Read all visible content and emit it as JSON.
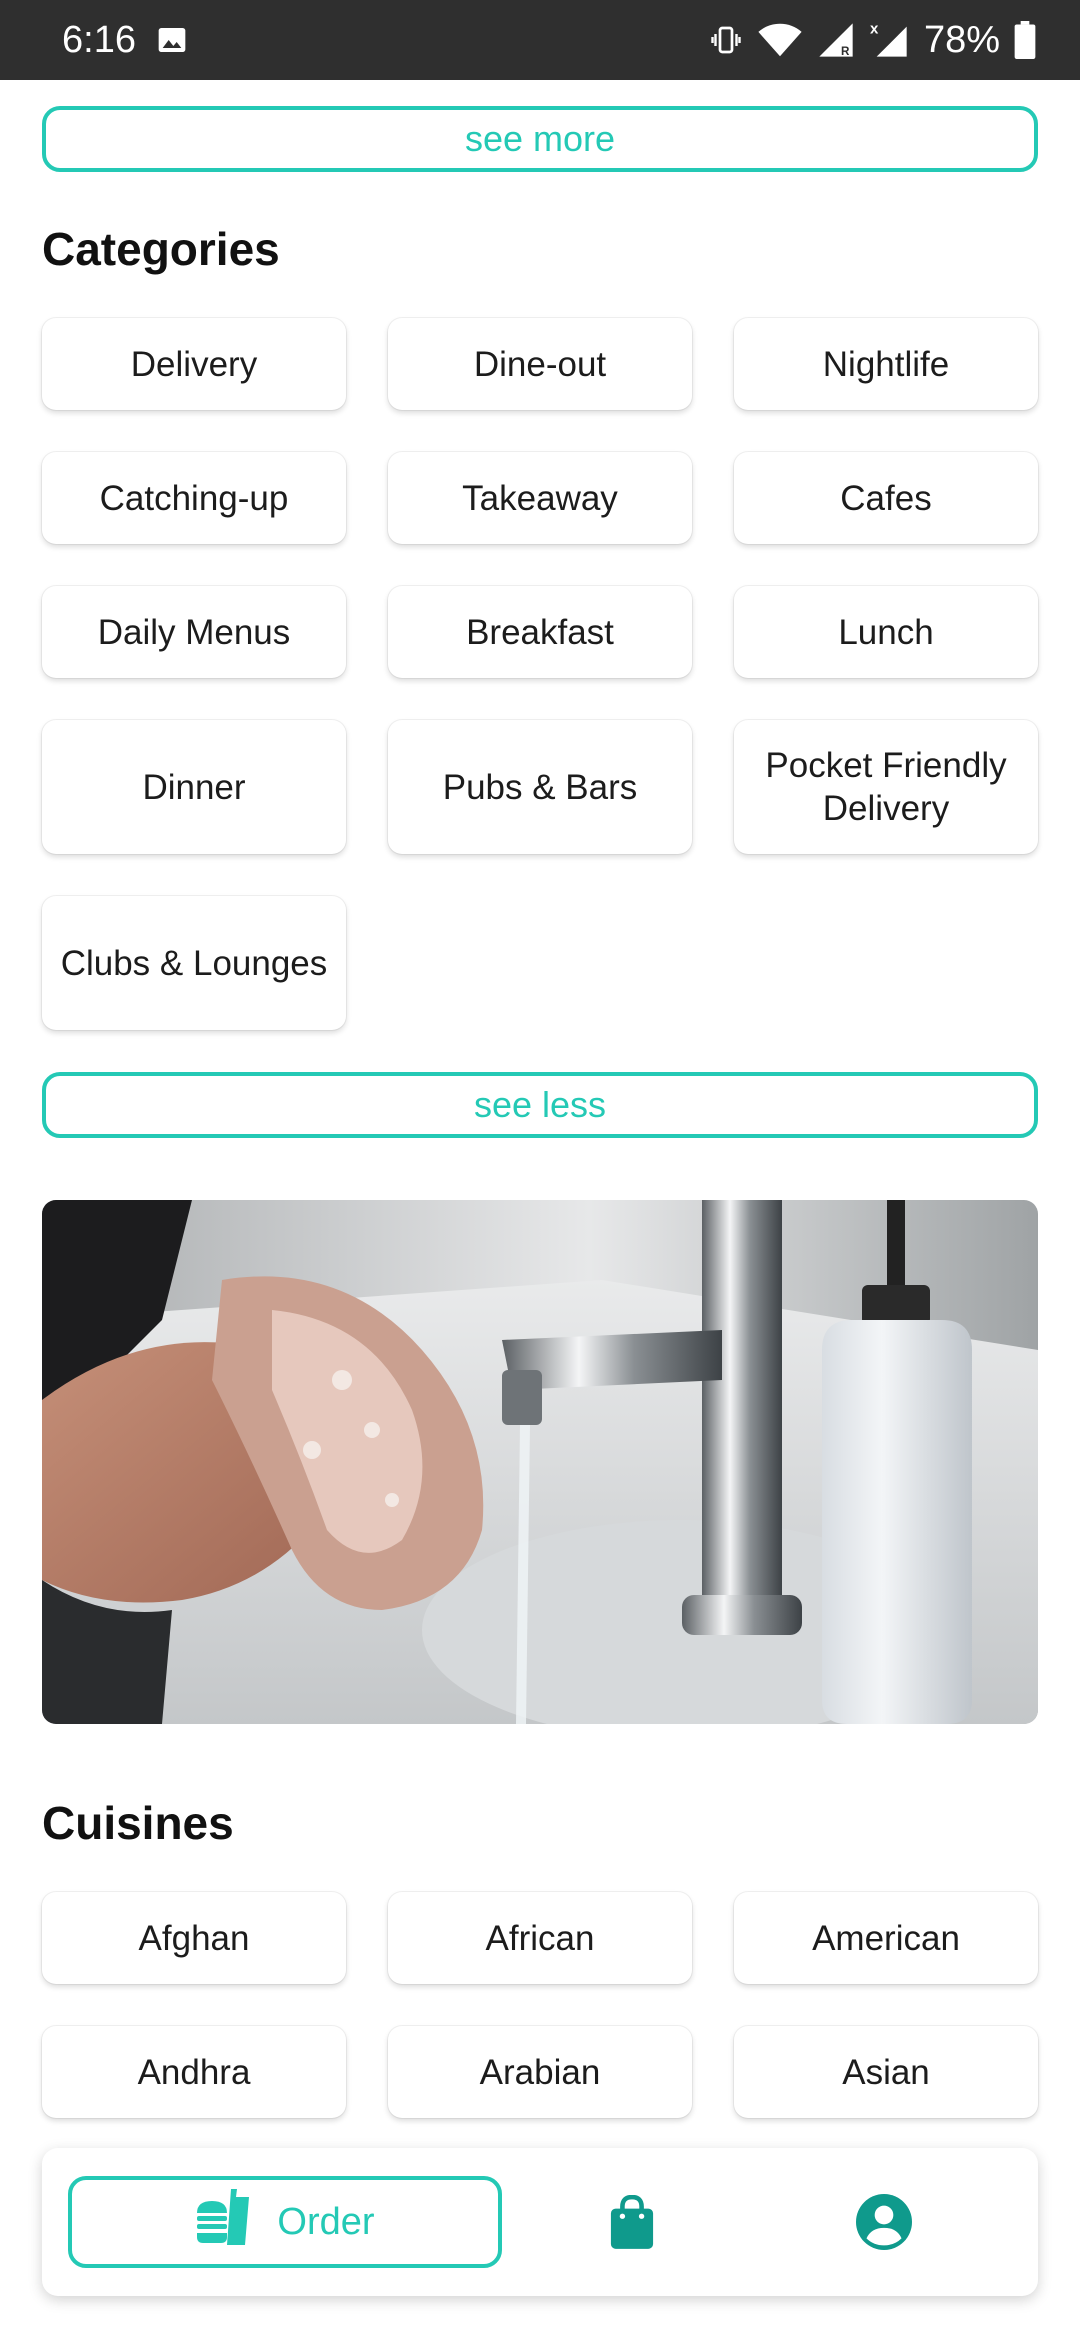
{
  "status_bar": {
    "time": "6:16",
    "battery": "78%",
    "icons": [
      "image-icon",
      "vibrate-icon",
      "wifi-icon",
      "signal-roaming-icon",
      "signal-icon",
      "battery-icon"
    ]
  },
  "top_toggle": {
    "label": "see more"
  },
  "categories": {
    "title": "Categories",
    "items": [
      "Delivery",
      "Dine-out",
      "Nightlife",
      "Catching-up",
      "Takeaway",
      "Cafes",
      "Daily Menus",
      "Breakfast",
      "Lunch",
      "Dinner",
      "Pubs & Bars",
      "Pocket Friendly Delivery",
      "Clubs & Lounges"
    ],
    "toggle_label": "see less"
  },
  "banner": {
    "icon": "hand-washing-image"
  },
  "cuisines": {
    "title": "Cuisines",
    "items": [
      "Afghan",
      "African",
      "American",
      "Andhra",
      "Arabian",
      "Asian"
    ]
  },
  "bottom_nav": {
    "order_label": "Order",
    "icons": [
      "food-icon",
      "shopping-bag-icon",
      "profile-icon"
    ]
  },
  "colors": {
    "accent": "#24c9b5",
    "nav_icon": "#0f9a8c",
    "status_bar": "#2f2f2f"
  }
}
